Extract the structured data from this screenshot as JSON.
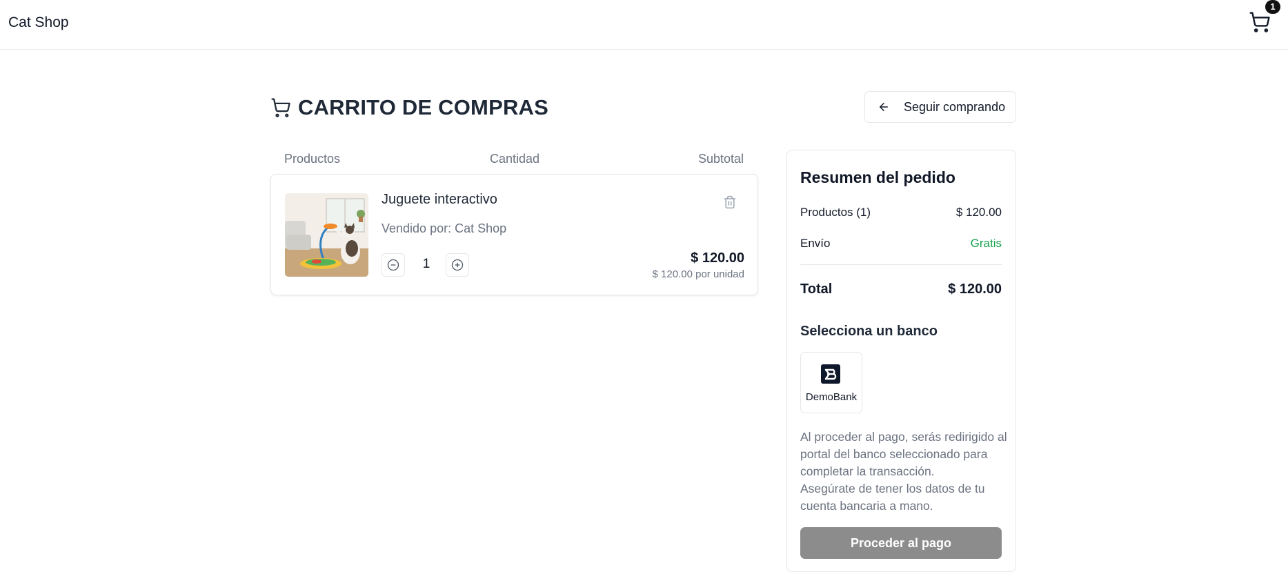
{
  "header": {
    "brand": "Cat Shop",
    "cart_count": "1"
  },
  "page": {
    "title": "CARRITO DE COMPRAS",
    "continue_label": "Seguir comprando"
  },
  "table": {
    "col_products": "Productos",
    "col_quantity": "Cantidad",
    "col_subtotal": "Subtotal"
  },
  "items": [
    {
      "name": "Juguete interactivo",
      "seller": "Vendido por: Cat Shop",
      "quantity": "1",
      "subtotal": "$ 120.00",
      "unit_price": "$ 120.00 por unidad"
    }
  ],
  "summary": {
    "title": "Resumen del pedido",
    "products_label": "Productos (1)",
    "products_value": "$ 120.00",
    "shipping_label": "Envío",
    "shipping_value": "Gratis",
    "total_label": "Total",
    "total_value": "$ 120.00",
    "bank_heading": "Selecciona un banco",
    "banks": [
      {
        "name": "DemoBank",
        "icon": "demobank-logo-icon"
      }
    ],
    "notice_line1": "Al proceder al pago, serás redirigido al portal del banco seleccionado para completar la transacción.",
    "notice_line2": "Asegúrate de tener los datos de tu cuenta bancaria a mano.",
    "proceed_label": "Proceder al pago"
  },
  "colors": {
    "free_shipping": "#16a34a",
    "proceed_disabled": "#8c8c8c",
    "text_primary": "#111827",
    "text_muted": "#6b7280",
    "border": "#e5e7eb"
  }
}
